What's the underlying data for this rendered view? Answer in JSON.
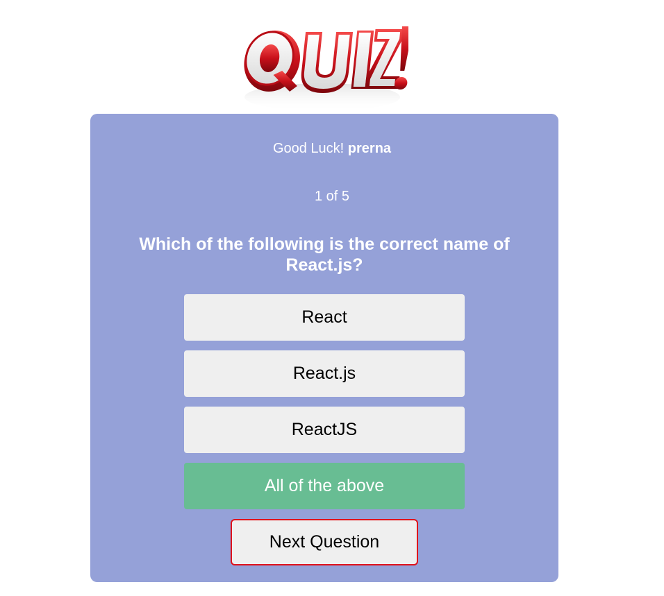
{
  "logo": {
    "text": "QUIZ!",
    "icon": "quiz-logo-icon"
  },
  "greeting": {
    "prefix": "Good Luck!",
    "username": "prerna"
  },
  "progress": "1 of 5",
  "question": "Which of the following is the correct name of React.js?",
  "options": [
    {
      "label": "React",
      "state": "default"
    },
    {
      "label": "React.js",
      "state": "default"
    },
    {
      "label": "ReactJS",
      "state": "default"
    },
    {
      "label": "All of the above",
      "state": "correct"
    }
  ],
  "next_button": "Next Question",
  "colors": {
    "card_background": "#95a1d8",
    "option_background": "#efefef",
    "correct_option": "#68bd93",
    "next_button_border": "#e0121b"
  }
}
